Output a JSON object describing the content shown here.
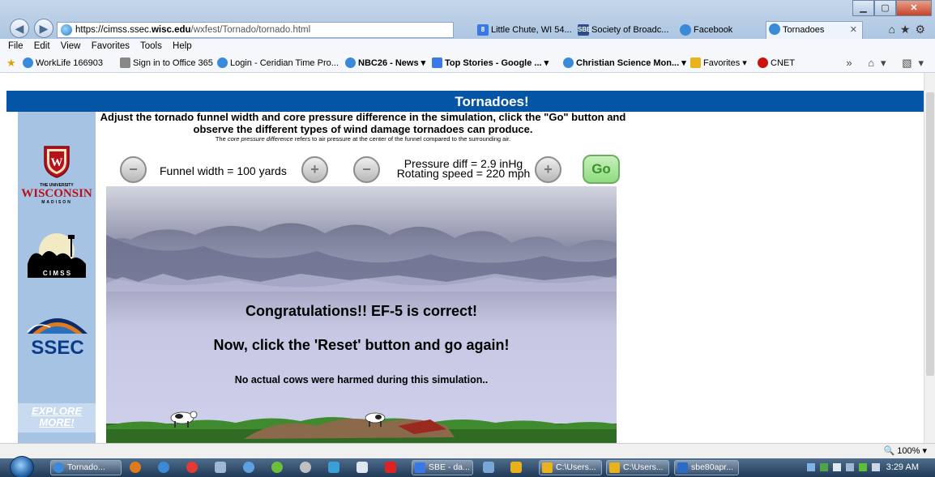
{
  "browser": {
    "url_host": "https://cimss.ssec.",
    "url_host_bold": "wisc.edu",
    "url_path": "/wxfest/Tornado/tornado.html",
    "tabs": [
      {
        "label": "Little Chute, WI 54...",
        "icon": "google-icon",
        "color": "#3b78e7"
      },
      {
        "label": "Society of Broadc...",
        "icon": "sbe-icon",
        "color": "#2b4d8a"
      },
      {
        "label": "Facebook",
        "icon": "ie-icon",
        "color": "#3b8ad8"
      },
      {
        "label": "Tornadoes",
        "icon": "ie-icon",
        "color": "#3b8ad8",
        "active": true
      }
    ],
    "menu": [
      "File",
      "Edit",
      "View",
      "Favorites",
      "Tools",
      "Help"
    ],
    "favorites": [
      {
        "label": "WorkLife 166903",
        "bold": false,
        "color": "#3b8ad8"
      },
      {
        "label": "Sign in to Office 365",
        "bold": false,
        "color": "#888"
      },
      {
        "label": "Login - Ceridian Time Pro...",
        "bold": false,
        "color": "#3b8ad8"
      },
      {
        "label": "NBC26 - News ▾",
        "bold": true,
        "color": "#3b8ad8"
      },
      {
        "label": "Top Stories - Google ... ▾",
        "bold": true,
        "color": "#3b78e7"
      },
      {
        "label": "Christian Science Mon... ▾",
        "bold": true,
        "color": "#3b8ad8"
      },
      {
        "label": "Favorites ▾",
        "bold": false,
        "color": "#e8b21c"
      },
      {
        "label": "CNET",
        "bold": false,
        "color": "#c11"
      }
    ],
    "zoom": "100%"
  },
  "page": {
    "banner_title": "Tornadoes!",
    "instructions": "Adjust the tornado funnel width and core pressure difference in the simulation, click the \"Go\" button and observe the different types of wind damage tornadoes can produce.",
    "note_prefix": "The ",
    "note_em": "core pressure difference",
    "note_suffix": " refers to air pressure at the center of the funnel compared to the surrounding air.",
    "funnel_label": "Funnel width = 100 yards",
    "pressure_label": "Pressure diff = 2.9 inHg",
    "speed_label": "Rotating speed = 220 mph",
    "minus_symbol": "−",
    "plus_symbol": "+",
    "go_label": "Go",
    "message_1": "Congratulations!! EF-5 is correct!",
    "message_2": "Now, click the 'Reset' button and go again!",
    "message_3": "No actual cows were harmed during this simulation..",
    "sidebar": {
      "uw_top": "THE UNIVERSITY",
      "uw_name": "WISCONSIN",
      "uw_sub": "MADISON",
      "cimss": "C I M S S",
      "ssec": "SSEC",
      "explore": "EXPLORE MORE!"
    }
  },
  "taskbar": {
    "items": [
      {
        "label": "Tornado...",
        "color": "#3b8ad8"
      },
      {
        "label": "SBE - da...",
        "color": "#3b78e7"
      },
      {
        "label": "C:\\Users...",
        "color": "#e8b21c"
      },
      {
        "label": "C:\\Users...",
        "color": "#e8b21c"
      },
      {
        "label": "sbe80apr...",
        "color": "#2a6ac9"
      }
    ],
    "clock": "3:29 AM"
  },
  "colors": {
    "banner": "#0555a6",
    "sidebar": "#a6c3e4",
    "go_button": "#8fdc7f"
  }
}
